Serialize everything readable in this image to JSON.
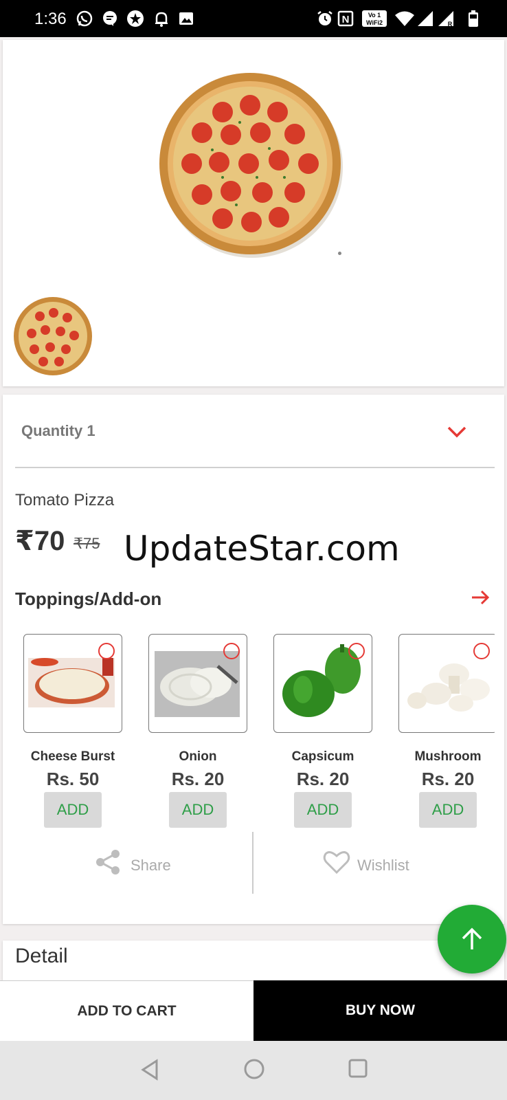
{
  "status_bar": {
    "time": "1:36",
    "icons": [
      "whatsapp-icon",
      "message-icon",
      "star-icon",
      "bell-icon",
      "image-icon",
      "alarm-icon",
      "nfc-icon",
      "vowifi-icon",
      "wifi-icon",
      "signal-icon",
      "signal-roaming-icon",
      "battery-icon"
    ],
    "vowifi_label": "Vo WiFi2"
  },
  "gallery": {
    "main_image": "pizza-image",
    "thumbnails": [
      "pizza-thumbnail"
    ]
  },
  "product": {
    "quantity_label": "Quantity 1",
    "name": "Tomato Pizza",
    "price": "₹70",
    "mrp": "₹75"
  },
  "watermark": "UpdateStar.com",
  "toppings": {
    "title": "Toppings/Add-on",
    "items": [
      {
        "name": "Cheese Burst",
        "price": "Rs. 50",
        "add_label": "ADD"
      },
      {
        "name": "Onion",
        "price": "Rs. 20",
        "add_label": "ADD"
      },
      {
        "name": "Capsicum",
        "price": "Rs. 20",
        "add_label": "ADD"
      },
      {
        "name": "Mushroom",
        "price": "Rs. 20",
        "add_label": "ADD"
      }
    ]
  },
  "actions": {
    "share_label": "Share",
    "wishlist_label": "Wishlist"
  },
  "detail": {
    "title": "Detail"
  },
  "bottom": {
    "add_to_cart": "ADD TO CART",
    "buy_now": "BUY NOW"
  },
  "colors": {
    "accent_red": "#e53935",
    "add_green": "#2e9e48",
    "fab_green": "#22ab36"
  }
}
